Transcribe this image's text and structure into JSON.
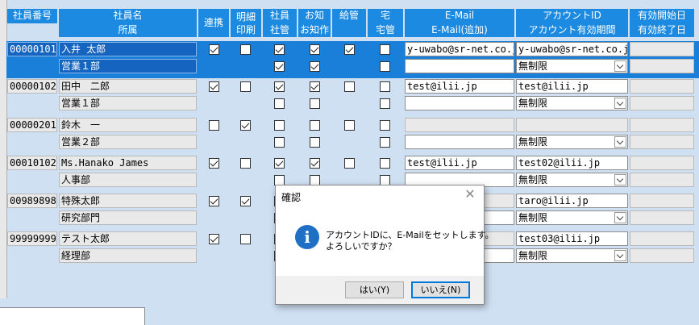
{
  "headers": {
    "emp_no": "社員番号",
    "emp_name": "社員名",
    "dept": "所属",
    "renkei": "連携",
    "meisai1": "明細",
    "meisai2": "印刷",
    "shain1": "社員",
    "shain2": "社管",
    "oshirase1": "お知",
    "oshirase2": "お知作",
    "kyukan": "給管",
    "taku1": "宅",
    "taku2": "宅管",
    "email1": "E-Mail",
    "email2": "E-Mail(追加)",
    "account1": "アカウントID",
    "account2": "アカウント有効期間",
    "valid1": "有効開始日",
    "valid2": "有効終了日"
  },
  "rows": [
    {
      "emp_no": "00000101",
      "name": "入井 太郎",
      "dept": "営業１部",
      "renkei": true,
      "meisai": false,
      "shain": true,
      "shainkan": true,
      "oshirase": true,
      "oshirasesaku": true,
      "kyukan": true,
      "taku": false,
      "takukan": false,
      "email": "y-uwabo@sr-net.co.jp",
      "email2": "",
      "account": "y-uwabo@sr-net.co.jp",
      "period": "無制限",
      "selected": true
    },
    {
      "emp_no": "00000102",
      "name": "田中　二郎",
      "dept": "営業１部",
      "renkei": true,
      "meisai": false,
      "shain": true,
      "shainkan": false,
      "oshirase": true,
      "oshirasesaku": false,
      "kyukan": false,
      "taku": false,
      "takukan": false,
      "email": "test@ilii.jp",
      "email2": "",
      "account": "test@ilii.jp",
      "period": "無制限",
      "selected": false
    },
    {
      "emp_no": "00000201",
      "name": "鈴木　一",
      "dept": "営業２部",
      "renkei": false,
      "meisai": true,
      "shain": false,
      "shainkan": false,
      "oshirase": false,
      "oshirasesaku": false,
      "kyukan": false,
      "taku": false,
      "takukan": false,
      "email": "",
      "email2": "",
      "account": "",
      "period": "無制限",
      "selected": false
    },
    {
      "emp_no": "00010102",
      "name": "Ms.Hanako James",
      "dept": "人事部",
      "renkei": true,
      "meisai": false,
      "shain": true,
      "shainkan": false,
      "oshirase": true,
      "oshirasesaku": false,
      "kyukan": false,
      "taku": false,
      "takukan": false,
      "email": "test@ilii.jp",
      "email2": "",
      "account": "test02@ilii.jp",
      "period": "無制限",
      "selected": false
    },
    {
      "emp_no": "00989898",
      "name": "特殊太郎",
      "dept": "研究部門",
      "renkei": true,
      "meisai": true,
      "shain": false,
      "shainkan": false,
      "oshirase": false,
      "oshirasesaku": false,
      "kyukan": false,
      "taku": false,
      "takukan": false,
      "email": "",
      "email2": "",
      "account": "taro@ilii.jp",
      "period": "無制限",
      "selected": false
    },
    {
      "emp_no": "99999999",
      "name": "テスト太郎",
      "dept": "経理部",
      "renkei": true,
      "meisai": false,
      "shain": false,
      "shainkan": false,
      "oshirase": false,
      "oshirasesaku": false,
      "kyukan": false,
      "taku": false,
      "takukan": false,
      "email": "",
      "email2": "",
      "account": "test03@ilii.jp",
      "period": "無制限",
      "selected": false
    }
  ],
  "dialog": {
    "title": "確認",
    "message1": "アカウントIDに、E-Mailをセットします。",
    "message2": "よろしいですか？",
    "yes": "はい(Y)",
    "no": "いいえ(N)",
    "icon": "info-icon",
    "close_icon": "close-icon"
  },
  "colors": {
    "header": "#1b8ae0",
    "selected_row": "#1a7fd9",
    "background": "#cfe0f3"
  }
}
